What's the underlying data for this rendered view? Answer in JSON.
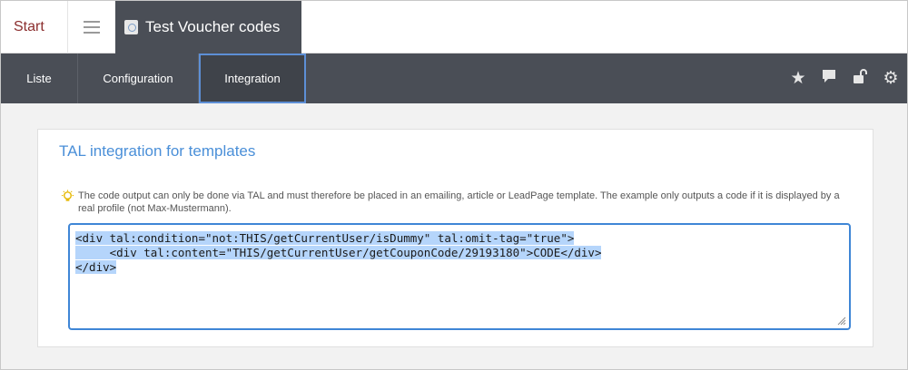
{
  "topbar": {
    "start_label": "Start",
    "doc_title": "Test Voucher codes"
  },
  "nav": {
    "tabs": [
      {
        "label": "Liste"
      },
      {
        "label": "Configuration"
      },
      {
        "label": "Integration",
        "active": true
      }
    ],
    "icons": [
      "star-icon",
      "comment-icon",
      "unlock-icon",
      "gear-icon"
    ]
  },
  "card": {
    "title": "TAL integration for templates",
    "hint": "The code output can only be done via TAL and must therefore be placed in an emailing, article or LeadPage template. The example only outputs a code if it is displayed by a real profile (not Max-Mustermann).",
    "code_lines": [
      "<div tal:condition=\"not:THIS/getCurrentUser/isDummy\" tal:omit-tag=\"true\">",
      "     <div tal:content=\"THIS/getCurrentUser/getCouponCode/29193180\">CODE</div>",
      "</div>"
    ]
  },
  "colors": {
    "accent": "#4a8fd8",
    "nav_bg": "#4a4e56",
    "start_text": "#8b2e2e",
    "selection": "#b5d5fb"
  }
}
